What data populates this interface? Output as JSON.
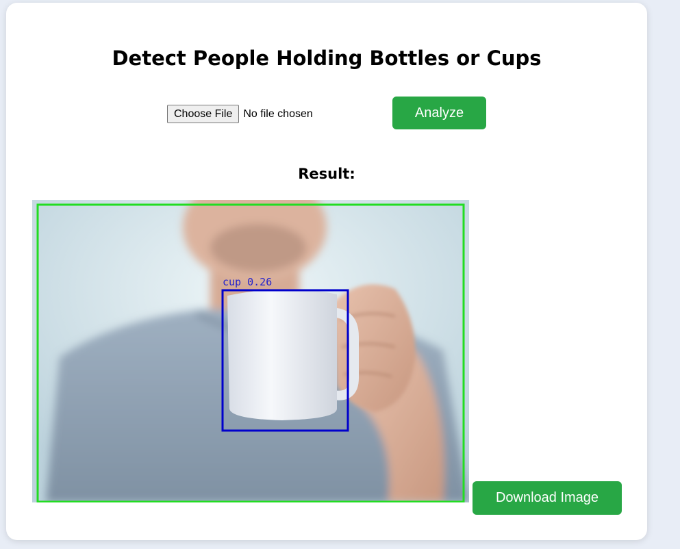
{
  "header": {
    "title": "Detect People Holding Bottles or Cups"
  },
  "upload": {
    "choose_file_label": "Choose File",
    "file_status": "No file chosen",
    "analyze_label": "Analyze"
  },
  "result": {
    "heading": "Result:",
    "detections": [
      {
        "label": "cup 0.26",
        "box_color": "#0000cc"
      },
      {
        "label": "",
        "box_color": "#22dd22"
      }
    ],
    "download_label": "Download Image"
  },
  "colors": {
    "accent_green": "#28a745",
    "page_background": "#e8edf6",
    "person_box": "#22dd22",
    "cup_box": "#0000cc"
  }
}
